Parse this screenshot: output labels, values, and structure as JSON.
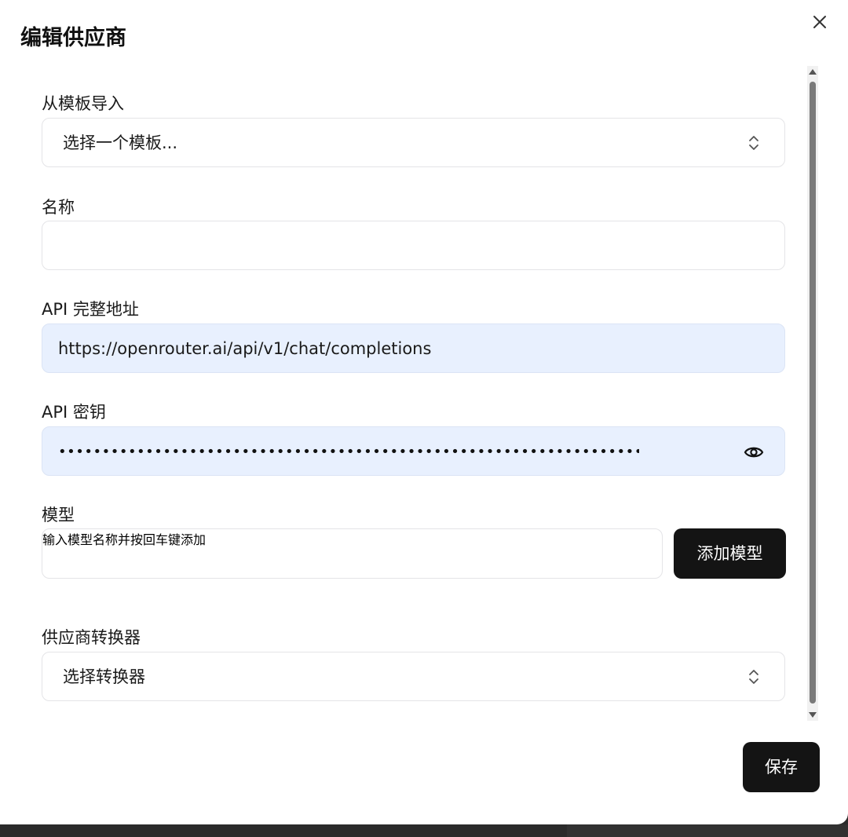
{
  "dialog": {
    "title": "编辑供应商",
    "close_icon": "close-icon"
  },
  "template": {
    "label": "从模板导入",
    "value": "选择一个模板..."
  },
  "name": {
    "label": "名称",
    "value": ""
  },
  "api_url": {
    "label": "API 完整地址",
    "value": "https://openrouter.ai/api/v1/chat/completions"
  },
  "api_key": {
    "label": "API 密钥",
    "masked_value": "••••••••••••••••••••••••••••••••••••••••••••••••••••••••••••••••••••••••",
    "toggle_icon": "eye-icon"
  },
  "models": {
    "label": "模型",
    "placeholder": "输入模型名称并按回车键添加",
    "add_button": "添加模型"
  },
  "transformer": {
    "label": "供应商转换器",
    "value": "选择转换器"
  },
  "footer": {
    "save_button": "保存"
  },
  "colors": {
    "primary_button": "#141414",
    "autofill_bg": "#e8f0fe",
    "border": "#e4e4e7"
  }
}
